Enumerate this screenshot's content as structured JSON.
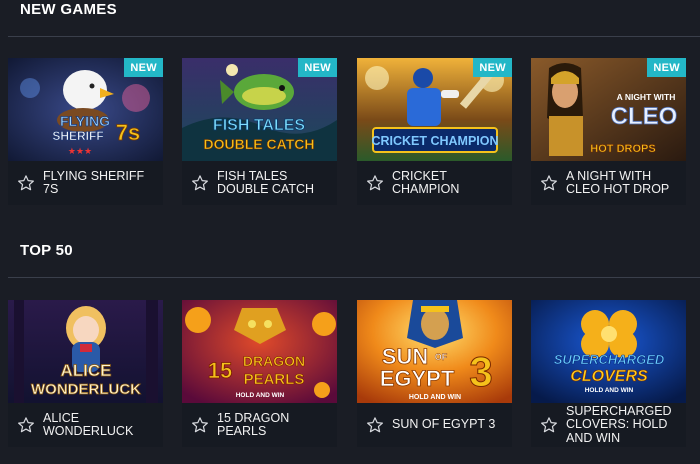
{
  "sections": [
    {
      "title": "NEW GAMES",
      "games": [
        {
          "name": "FLYING SHERIFF 7S",
          "badge": "NEW",
          "logo": [
            "FLYING",
            "SHERIFF",
            "7s"
          ]
        },
        {
          "name": "FISH TALES DOUBLE CATCH",
          "badge": "NEW",
          "logo": [
            "FISH TALES",
            "DOUBLE CATCH"
          ]
        },
        {
          "name": "CRICKET CHAMPION",
          "badge": "NEW",
          "logo": [
            "CRICKET CHAMPION"
          ]
        },
        {
          "name": "A NIGHT WITH CLEO HOT DROP",
          "badge": "NEW",
          "logo": [
            "A NIGHT WITH",
            "CLEO",
            "HOT DROPS"
          ]
        }
      ]
    },
    {
      "title": "TOP 50",
      "games": [
        {
          "name": "ALICE WONDERLUCK",
          "logo": [
            "ALICE",
            "WONDERLUCK"
          ]
        },
        {
          "name": "15 DRAGON PEARLS",
          "logo": [
            "15",
            "DRAGON",
            "PEARLS",
            "HOLD AND WIN"
          ]
        },
        {
          "name": "SUN OF EGYPT 3",
          "logo": [
            "SUN",
            "OF",
            "EGYPT",
            "3",
            "HOLD AND WIN"
          ]
        },
        {
          "name": "SUPERCHARGED CLOVERS: HOLD AND WIN",
          "logo": [
            "SUPERCHARGED",
            "CLOVERS",
            "HOLD AND WIN"
          ]
        }
      ]
    }
  ],
  "icons": {
    "favorite": "star-outline-icon"
  },
  "colors": {
    "background": "#1a1d25",
    "card": "#161a22",
    "badge": "#23b7c7",
    "text": "#ffffff"
  }
}
